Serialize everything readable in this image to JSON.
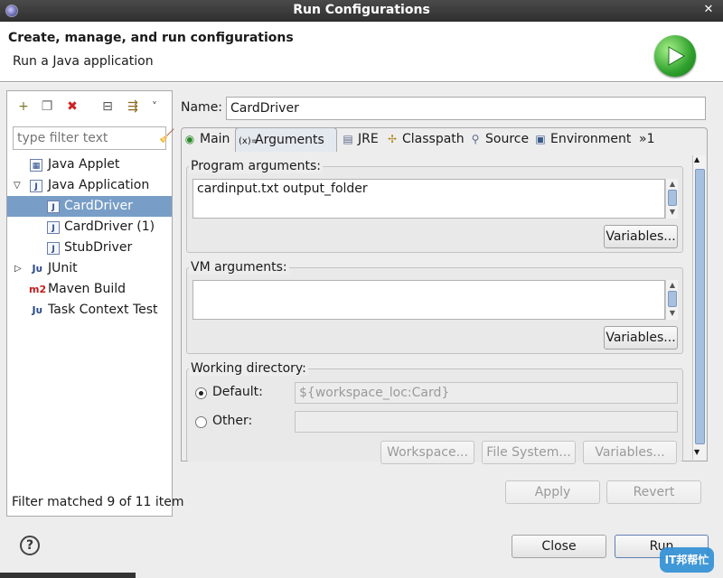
{
  "window": {
    "title": "Run Configurations"
  },
  "header": {
    "title": "Create, manage, and run configurations",
    "subtitle": "Run a Java application",
    "logo_icon": "run-launch-icon"
  },
  "left_panel": {
    "toolbar": [
      {
        "name": "new-launch-configuration",
        "icon": "new-file-icon",
        "glyph": "+"
      },
      {
        "name": "duplicate",
        "icon": "duplicate-icon",
        "glyph": "❐"
      },
      {
        "name": "delete",
        "icon": "delete-icon",
        "glyph": "✖"
      },
      {
        "name": "collapse-all",
        "icon": "collapse-all-icon",
        "glyph": "⊟"
      },
      {
        "name": "filter",
        "icon": "filter-icon",
        "glyph": "⇶"
      },
      {
        "name": "view-menu",
        "icon": "chevron-down-icon",
        "glyph": "˅"
      }
    ],
    "filter_placeholder": "type filter text",
    "tree": [
      {
        "label": "Java Applet",
        "icon": "java-applet-icon",
        "level": 0,
        "twisty": "",
        "selected": false
      },
      {
        "label": "Java Application",
        "icon": "java-application-icon",
        "level": 0,
        "twisty": "expanded",
        "selected": false
      },
      {
        "label": "CardDriver",
        "icon": "java-config-icon",
        "level": 1,
        "twisty": "",
        "selected": true
      },
      {
        "label": "CardDriver (1)",
        "icon": "java-config-icon",
        "level": 1,
        "twisty": "",
        "selected": false
      },
      {
        "label": "StubDriver",
        "icon": "java-config-icon",
        "level": 1,
        "twisty": "",
        "selected": false
      },
      {
        "label": "JUnit",
        "icon": "junit-icon",
        "level": 0,
        "twisty": "collapsed",
        "selected": false
      },
      {
        "label": "Maven Build",
        "icon": "maven-icon",
        "level": 0,
        "twisty": "",
        "selected": false
      },
      {
        "label": "Task Context Test",
        "icon": "task-context-test-icon",
        "level": 0,
        "twisty": "",
        "selected": false
      }
    ],
    "filter_status": "Filter matched 9 of 11 item"
  },
  "config": {
    "name_label": "Name:",
    "name_value": "CardDriver",
    "tabs": [
      {
        "label": "Main",
        "icon": "main-tab-icon",
        "active": false
      },
      {
        "label": "Arguments",
        "icon": "arguments-tab-icon",
        "active": true
      },
      {
        "label": "JRE",
        "icon": "jre-tab-icon",
        "active": false
      },
      {
        "label": "Classpath",
        "icon": "classpath-tab-icon",
        "active": false
      },
      {
        "label": "Source",
        "icon": "source-tab-icon",
        "active": false
      },
      {
        "label": "Environment",
        "icon": "environment-tab-icon",
        "active": false
      },
      {
        "label": "»1",
        "icon": "more-tabs-icon",
        "active": false
      }
    ],
    "program_args": {
      "label": "Program arguments:",
      "value": "cardinput.txt output_folder",
      "variables_button": "Variables..."
    },
    "vm_args": {
      "label": "VM arguments:",
      "value": "",
      "variables_button": "Variables..."
    },
    "working_dir": {
      "label": "Working directory:",
      "default_label": "Default:",
      "default_value": "${workspace_loc:Card}",
      "default_selected": true,
      "other_label": "Other:",
      "other_value": "",
      "workspace_button": "Workspace...",
      "filesystem_button": "File System...",
      "variables_button": "Variables..."
    },
    "apply_button": "Apply",
    "revert_button": "Revert"
  },
  "footer": {
    "help_icon": "help-icon",
    "close_button": "Close",
    "run_button": "Run",
    "watermark": "IT邦帮忙"
  }
}
